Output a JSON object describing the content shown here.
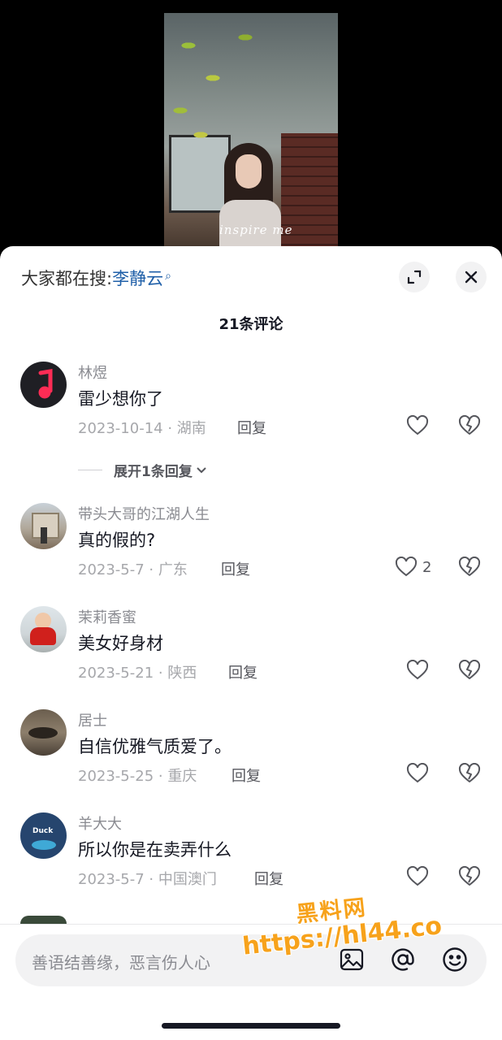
{
  "video": {
    "caption": "inspire me"
  },
  "header": {
    "search_prefix": "大家都在搜:",
    "search_keyword": "李静云",
    "title": "21条评论"
  },
  "comments": [
    {
      "name": "林煜",
      "text": "雷少想你了",
      "meta": "2023-10-14 · 湖南",
      "reply": "回复",
      "likes": ""
    },
    {
      "name": "带头大哥的江湖人生",
      "text": "真的假的?",
      "meta": "2023-5-7 · 广东",
      "reply": "回复",
      "likes": "2"
    },
    {
      "name": "茉莉香蜜",
      "text": "美女好身材",
      "meta": "2023-5-21 · 陕西",
      "reply": "回复",
      "likes": ""
    },
    {
      "name": "居士",
      "text": "自信优雅气质爱了。",
      "meta": "2023-5-25 · 重庆",
      "reply": "回复",
      "likes": ""
    },
    {
      "name": "羊大大",
      "text": "所以你是在卖弄什么",
      "meta": "2023-5-7 · 中国澳门",
      "reply": "回复",
      "likes": ""
    }
  ],
  "avatar_texts": {
    "duck": "Duck"
  },
  "expand_replies": "展开1条回复",
  "input": {
    "placeholder": "善语结善缘，恶言伤人心"
  },
  "watermark": {
    "line1": "黑料网",
    "line2": "https://hl44.co"
  },
  "colors": {
    "keyword": "#1f5fa8",
    "watermark": "#f7a21b",
    "music_avatar": "#fe2c55"
  }
}
